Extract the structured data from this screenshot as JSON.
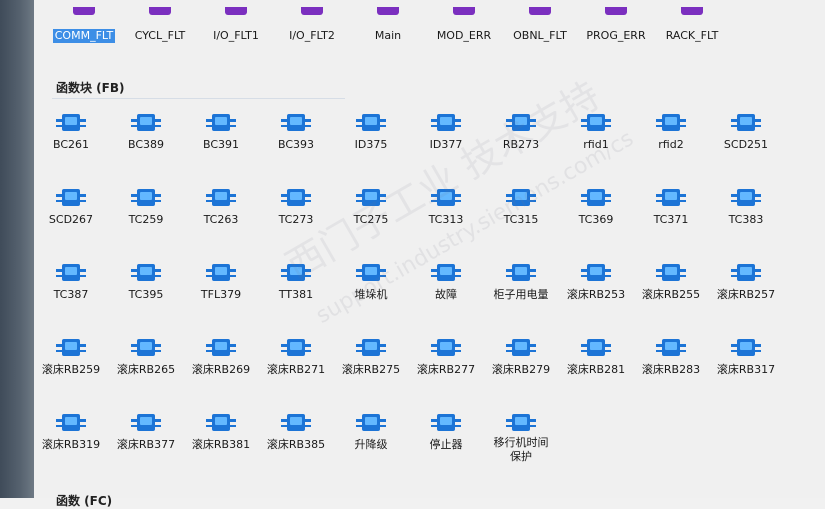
{
  "ob_blocks": [
    {
      "label": "COMM_FLT",
      "selected": true
    },
    {
      "label": "CYCL_FLT"
    },
    {
      "label": "I/O_FLT1"
    },
    {
      "label": "I/O_FLT2"
    },
    {
      "label": "Main"
    },
    {
      "label": "MOD_ERR"
    },
    {
      "label": "OBNL_FLT"
    },
    {
      "label": "PROG_ERR"
    },
    {
      "label": "RACK_FLT"
    }
  ],
  "fb_section": {
    "title": "函数块 (FB)"
  },
  "fb_blocks": [
    "BC261",
    "BC389",
    "BC391",
    "BC393",
    "ID375",
    "ID377",
    "RB273",
    "rfid1",
    "rfid2",
    "SCD251",
    "SCD267",
    "TC259",
    "TC263",
    "TC273",
    "TC275",
    "TC313",
    "TC315",
    "TC369",
    "TC371",
    "TC383",
    "TC387",
    "TC395",
    "TFL379",
    "TT381",
    "堆垛机",
    "故障",
    "柜子用电量",
    "滚床RB253",
    "滚床RB255",
    "滚床RB257",
    "滚床RB259",
    "滚床RB265",
    "滚床RB269",
    "滚床RB271",
    "滚床RB275",
    "滚床RB277",
    "滚床RB279",
    "滚床RB281",
    "滚床RB283",
    "滚床RB317",
    "滚床RB319",
    "滚床RB377",
    "滚床RB381",
    "滚床RB385",
    "升降级",
    "停止器",
    "移行机时间\n保护"
  ],
  "fc_section": {
    "title": "函数 (FC)"
  },
  "icon_colors": {
    "block_blue": "#1c74d6",
    "block_light": "#63b8ff",
    "ob_purple": "#7b2fbf"
  },
  "watermark": {
    "line1": "西门子工业 技术支持",
    "line2": "support.industry.siemens.com/cs"
  }
}
